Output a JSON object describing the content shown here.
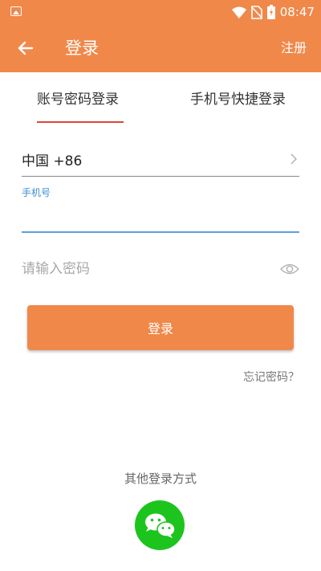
{
  "status_bar": {
    "time": "08:47"
  },
  "app_bar": {
    "title": "登录",
    "register_label": "注册"
  },
  "tabs": [
    {
      "label": "账号密码登录",
      "selected": true
    },
    {
      "label": "手机号快捷登录",
      "selected": false
    }
  ],
  "form": {
    "country": "中国 +86",
    "phone_label": "手机号",
    "phone_value": "",
    "password_placeholder": "请输入密码",
    "login_button": "登录",
    "forgot_password": "忘记密码？"
  },
  "other_login": {
    "label": "其他登录方式",
    "icon": "wechat-icon"
  },
  "colors": {
    "accent": "#f0884a",
    "tab_underline": "#d9473a",
    "input_focus": "#5b9fe0",
    "wechat": "#1ec41e"
  }
}
